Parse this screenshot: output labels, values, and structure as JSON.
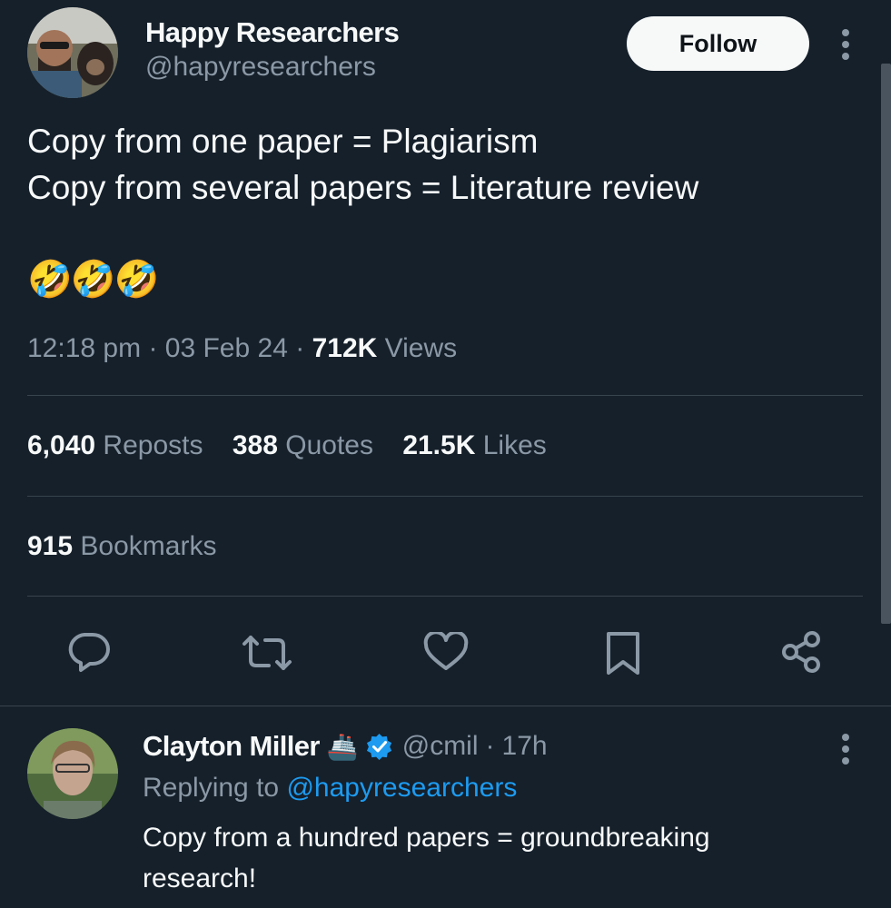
{
  "tweet": {
    "author_name": "Happy Researchers",
    "author_handle": "@hapyresearchers",
    "follow_label": "Follow",
    "line1": "Copy from one paper = Plagiarism",
    "line2": "Copy from several papers = Literature review",
    "emojis": "🤣🤣🤣",
    "time": "12:18 pm",
    "sep1": "·",
    "date": "03 Feb 24",
    "sep2": "·",
    "views_count": "712K",
    "views_label": "Views",
    "reposts_count": "6,040",
    "reposts_label": "Reposts",
    "quotes_count": "388",
    "quotes_label": "Quotes",
    "likes_count": "21.5K",
    "likes_label": "Likes",
    "bookmarks_count": "915",
    "bookmarks_label": "Bookmarks"
  },
  "actions": [
    {
      "icon": "reply-icon"
    },
    {
      "icon": "repost-icon"
    },
    {
      "icon": "like-icon"
    },
    {
      "icon": "bookmark-icon"
    },
    {
      "icon": "share-icon"
    }
  ],
  "reply": {
    "author_name": "Clayton Miller",
    "badge_emoji": "🚢",
    "author_handle": "@cmil",
    "sep": "·",
    "time": "17h",
    "replying_prefix": "Replying to",
    "replying_handle": "@hapyresearchers",
    "text": "Copy from a hundred papers = groundbreaking research!"
  },
  "colors": {
    "background": "#15202b",
    "text": "#f7f9f9",
    "muted": "#8b98a5",
    "link": "#1d9bf0",
    "divider": "#38444d",
    "follow_bg": "#f7f9f9"
  }
}
